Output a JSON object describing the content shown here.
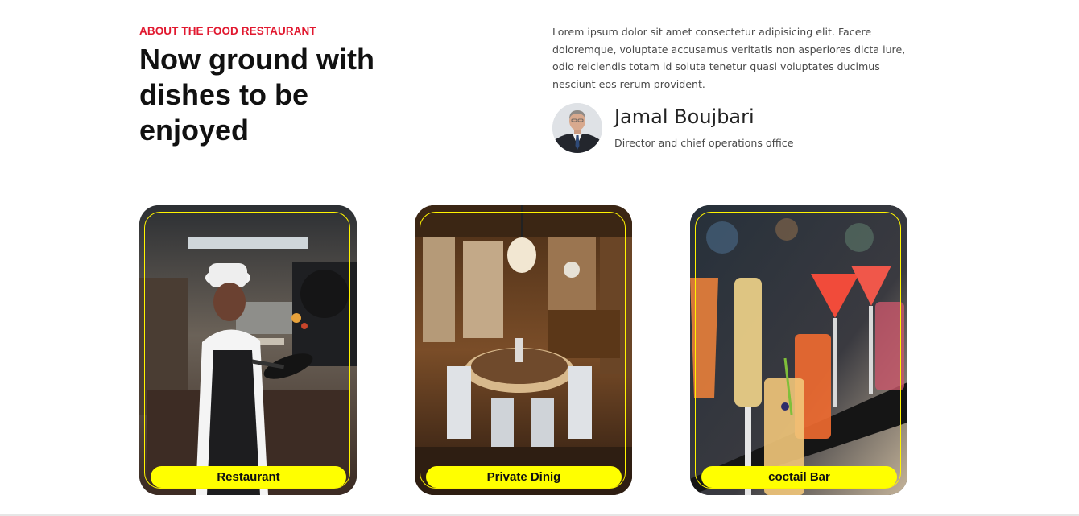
{
  "about": {
    "kicker": "ABOUT THE FOOD RESTAURANT",
    "headline": "Now ground with dishes to be enjoyed",
    "description": "Lorem ipsum dolor sit amet consectetur adipisicing elit. Facere doloremque, voluptate accusamus veritatis non asperiores dicta iure, odio reiciendis totam id soluta tenetur quasi voluptates ducimus nesciunt eos rerum provident.",
    "author": {
      "name": "Jamal Boujbari",
      "role": "Director and chief operations office"
    }
  },
  "cards": [
    {
      "label": "Restaurant",
      "image": "chef-cooking-photo"
    },
    {
      "label": "Private Dinig",
      "image": "private-dining-room-photo"
    },
    {
      "label": "coctail Bar",
      "image": "cocktails-photo"
    }
  ],
  "colors": {
    "accent_red": "#e1182f",
    "label_yellow": "#ffff00",
    "frame_yellow": "#fff400",
    "heading": "#111111",
    "body_text": "#4a4a4a"
  }
}
